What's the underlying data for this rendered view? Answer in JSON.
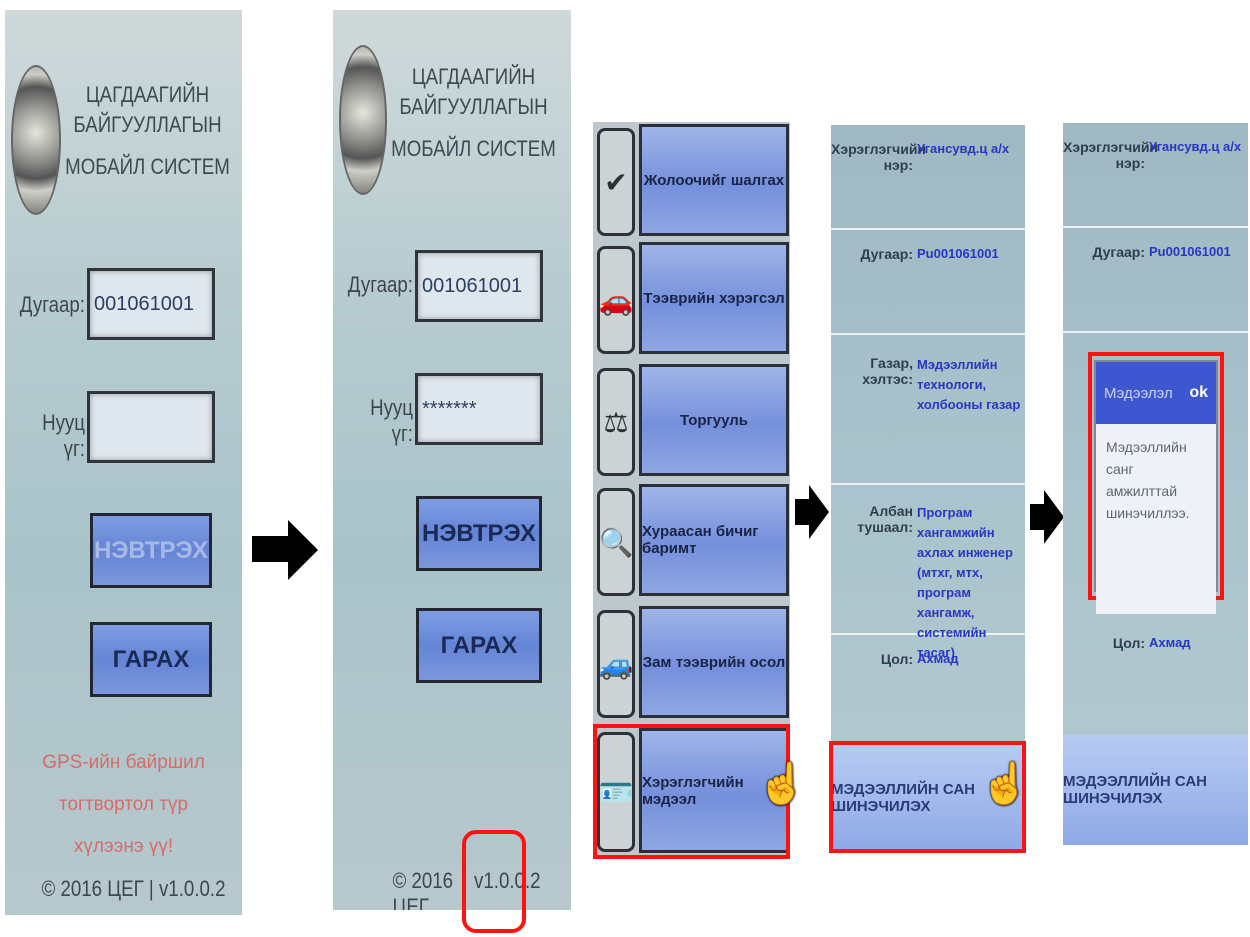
{
  "login": {
    "org_line1": "ЦАГДААГИЙН БАЙГУУЛЛАГЫН",
    "org_line2": "МОБАЙЛ СИСТЕМ",
    "id_label": "Дугаар:",
    "id_value": "001061001",
    "pass_label": "Нууц үг:",
    "pass_value": "*******",
    "login_button": "НЭВТРЭХ",
    "exit_button": "ГАРАХ",
    "gps_line1": "GPS-ийн байршил тогтвортол түр",
    "gps_line2": "хүлээнэ үү!",
    "footer": "© 2016 ЦЕГ | v1.0.0.2",
    "footer_prefix": "© 2016 ЦЕГ",
    "footer_version": "v1.0.0.2"
  },
  "menu": {
    "items": [
      {
        "label": "Жолоочийг шалгах",
        "icon": "checkmark-icon",
        "glyph": "✔"
      },
      {
        "label": "Тээврийн хэрэгсэл",
        "icon": "car-icon",
        "glyph": "🚗"
      },
      {
        "label": "Торгууль",
        "icon": "scales-icon",
        "glyph": "⚖"
      },
      {
        "label": "Хураасан бичиг баримт",
        "icon": "magnifier-icon",
        "glyph": "🔍"
      },
      {
        "label": "Зам тээврийн осол",
        "icon": "crash-icon",
        "glyph": "🚙"
      },
      {
        "label": "Хэрэглэгчийн мэдээл",
        "icon": "id-card-icon",
        "glyph": "🪪"
      }
    ]
  },
  "user_info": {
    "rows": [
      {
        "label": "Хэрэглэгчийн нэр:",
        "value": "Угансувд.ц а/х"
      },
      {
        "label": "Дугаар:",
        "value": "Pu001061001"
      },
      {
        "label": "Газар, хэлтэс:",
        "value": "Мэдээллийн технологи, холбооны газар"
      },
      {
        "label": "Албан тушаал:",
        "value": "Програм хангамжийн ахлах инженер (мтхг, мтх, програм хангамж, системийн тасаг)"
      },
      {
        "label": "Цол:",
        "value": "Ахмад"
      }
    ],
    "update_button": "МЭДЭЭЛЛИЙН САН ШИНЭЧИЛЭХ"
  },
  "dialog": {
    "title": "Мэдээлэл",
    "ok": "ok",
    "message": "Мэдээллийн санг амжилттай шинэчиллээ."
  },
  "colors": {
    "highlight": "#ff1212",
    "button_blue": "#7190dc",
    "link_blue": "#2836c6"
  }
}
